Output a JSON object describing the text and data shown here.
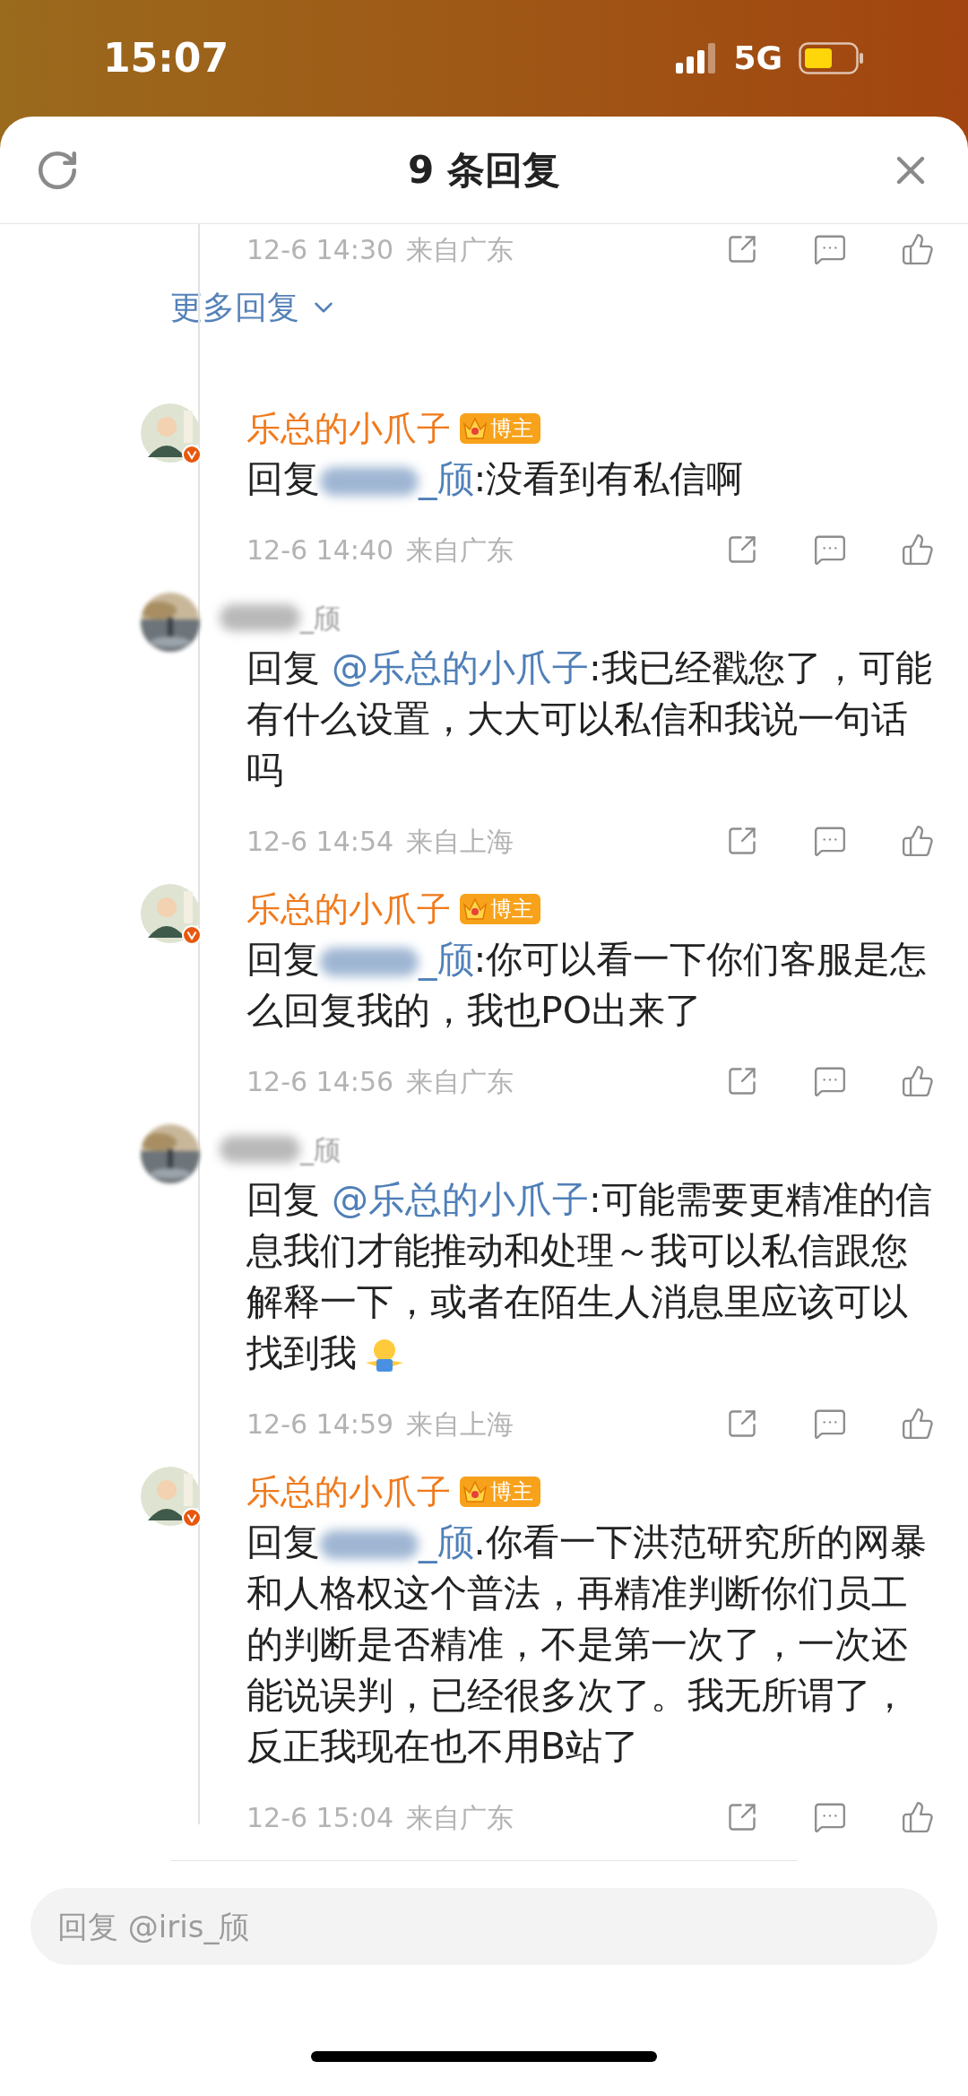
{
  "status_bar": {
    "time": "15:07",
    "network": "5G"
  },
  "header": {
    "title": "9 条回复"
  },
  "top_meta": {
    "time": "12-6 14:30",
    "location": "来自广东"
  },
  "more_replies": "更多回复",
  "comments": [
    {
      "author": "乐总的小爪子",
      "author_blurred": false,
      "verified": true,
      "badge": "博主",
      "reply_prefix": "回复",
      "mention": "_颀",
      "mention_blurred": true,
      "text": ":没看到有私信啊",
      "trailing_emoji": false,
      "time": "12-6 14:40",
      "location": "来自广东"
    },
    {
      "author": "_颀",
      "author_blurred": true,
      "verified": false,
      "reply_prefix": "回复",
      "mention": "@乐总的小爪子",
      "mention_blurred": false,
      "text": ":我已经戳您了，可能有什么设置，大大可以私信和我说一句话吗",
      "trailing_emoji": false,
      "time": "12-6 14:54",
      "location": "来自上海"
    },
    {
      "author": "乐总的小爪子",
      "author_blurred": false,
      "verified": true,
      "badge": "博主",
      "reply_prefix": "回复",
      "mention": "_颀",
      "mention_blurred": true,
      "text": ":你可以看一下你们客服是怎么回复我的，我也PO出来了",
      "trailing_emoji": false,
      "time": "12-6 14:56",
      "location": "来自广东"
    },
    {
      "author": "_颀",
      "author_blurred": true,
      "verified": false,
      "reply_prefix": "回复",
      "mention": "@乐总的小爪子",
      "mention_blurred": false,
      "text": ":可能需要更精准的信息我们才能推动和处理～我可以私信跟您解释一下，或者在陌生人消息里应该可以找到我",
      "trailing_emoji": true,
      "time": "12-6 14:59",
      "location": "来自上海"
    },
    {
      "author": "乐总的小爪子",
      "author_blurred": false,
      "verified": true,
      "badge": "博主",
      "reply_prefix": "回复",
      "mention": "_颀",
      "mention_blurred": true,
      "text": ".你看一下洪范研究所的网暴和人格权这个普法，再精准判断你们员工的判断是否精准，不是第一次了，一次还能说误判，已经很多次了。我无所谓了，反正我现在也不用B站了",
      "trailing_emoji": false,
      "time": "12-6 15:04",
      "location": "来自广东"
    }
  ],
  "reply_box": {
    "placeholder": "回复 @iris_颀"
  }
}
